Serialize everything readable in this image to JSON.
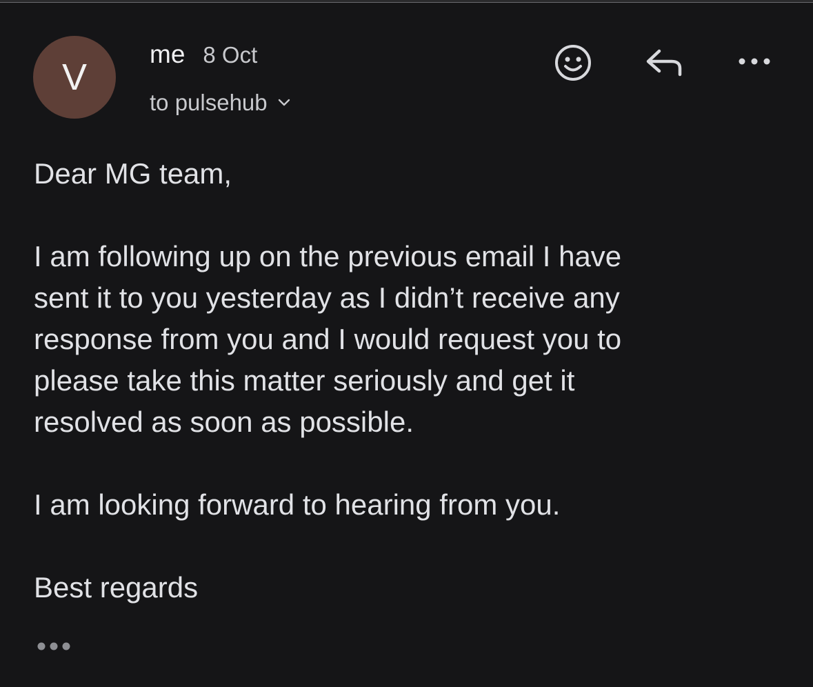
{
  "message": {
    "avatar_letter": "V",
    "avatar_color": "#5e3f37",
    "sender": "me",
    "date": "8 Oct",
    "recipient": "to pulsehub"
  },
  "actions": {
    "emoji_icon": "smiley-face-icon",
    "reply_icon": "reply-arrow-icon",
    "more_icon": "more-horizontal-icon"
  },
  "body": {
    "greeting": "Dear MG team,",
    "paragraph1_lines": [
      "I am following up on the previous email I have",
      "sent it to you yesterday as I didn’t receive any",
      "response from you and I would request you to",
      "please take this matter seriously and get it",
      "resolved as soon as possible."
    ],
    "paragraph2": "I am looking forward to hearing from you.",
    "signoff": "Best regards"
  },
  "trimmed_content_icon": "ellipsis-icon"
}
